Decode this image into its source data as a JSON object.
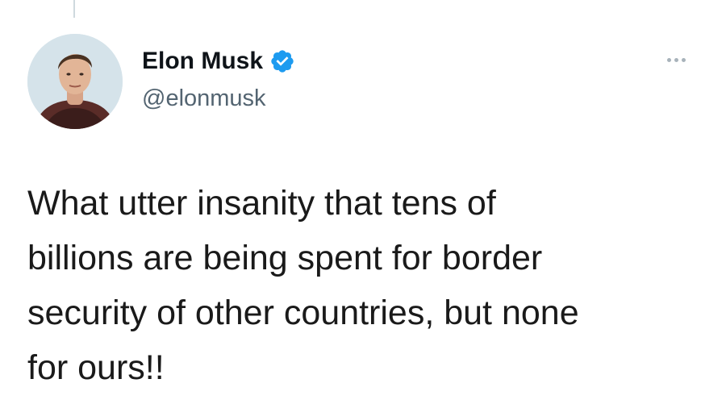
{
  "tweet": {
    "author": {
      "display_name": "Elon Musk",
      "handle": "@elonmusk",
      "verified": true
    },
    "text_lines": [
      "What utter insanity that tens of",
      "billions are being spent for border",
      "security of other countries, but none",
      "for ours!!"
    ],
    "icons": {
      "verified": "verified-badge-icon",
      "more": "more-options-icon"
    },
    "colors": {
      "verified_badge": "#1d9bf0",
      "handle_text": "#536471",
      "name_text": "#0f1419"
    }
  }
}
